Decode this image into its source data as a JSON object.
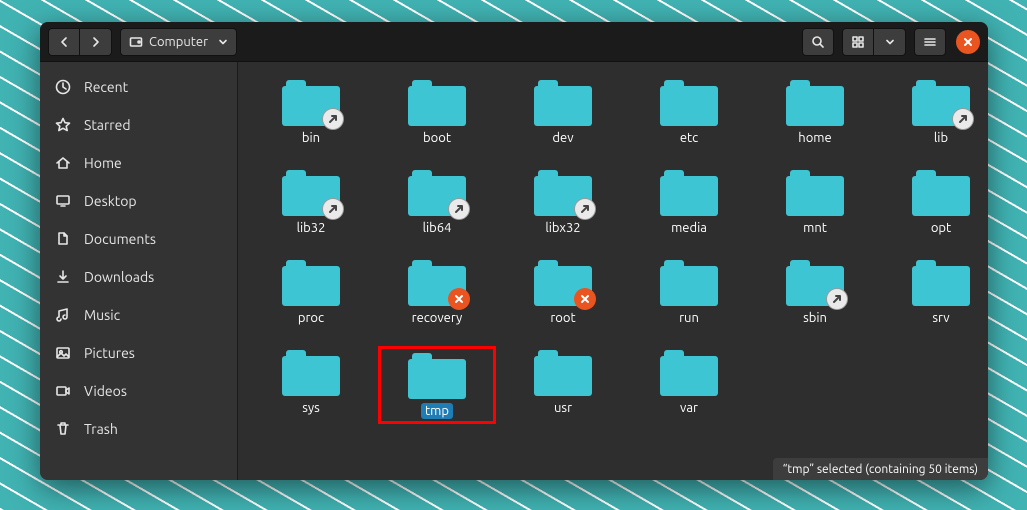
{
  "path": {
    "label": "Computer"
  },
  "sidebar": [
    {
      "name": "recent",
      "label": "Recent",
      "icon": "clock-icon"
    },
    {
      "name": "starred",
      "label": "Starred",
      "icon": "star-icon"
    },
    {
      "name": "home",
      "label": "Home",
      "icon": "house-icon"
    },
    {
      "name": "desktop",
      "label": "Desktop",
      "icon": "monitor-icon"
    },
    {
      "name": "documents",
      "label": "Documents",
      "icon": "file-icon"
    },
    {
      "name": "downloads",
      "label": "Downloads",
      "icon": "download-icon"
    },
    {
      "name": "music",
      "label": "Music",
      "icon": "music-icon"
    },
    {
      "name": "pictures",
      "label": "Pictures",
      "icon": "picture-icon"
    },
    {
      "name": "videos",
      "label": "Videos",
      "icon": "video-icon"
    },
    {
      "name": "trash",
      "label": "Trash",
      "icon": "trash-icon"
    }
  ],
  "items": [
    {
      "label": "bin",
      "badge": "link"
    },
    {
      "label": "boot"
    },
    {
      "label": "dev"
    },
    {
      "label": "etc"
    },
    {
      "label": "home"
    },
    {
      "label": "lib",
      "badge": "link"
    },
    {
      "label": "lib32",
      "badge": "link"
    },
    {
      "label": "lib64",
      "badge": "link"
    },
    {
      "label": "libx32",
      "badge": "link"
    },
    {
      "label": "media"
    },
    {
      "label": "mnt"
    },
    {
      "label": "opt"
    },
    {
      "label": "proc"
    },
    {
      "label": "recovery",
      "badge": "deny"
    },
    {
      "label": "root",
      "badge": "deny"
    },
    {
      "label": "run"
    },
    {
      "label": "sbin",
      "badge": "link"
    },
    {
      "label": "srv"
    },
    {
      "label": "sys"
    },
    {
      "label": "tmp",
      "selected": true,
      "highlight": true
    },
    {
      "label": "usr"
    },
    {
      "label": "var"
    }
  ],
  "status": "“tmp” selected  (containing 50 items)"
}
